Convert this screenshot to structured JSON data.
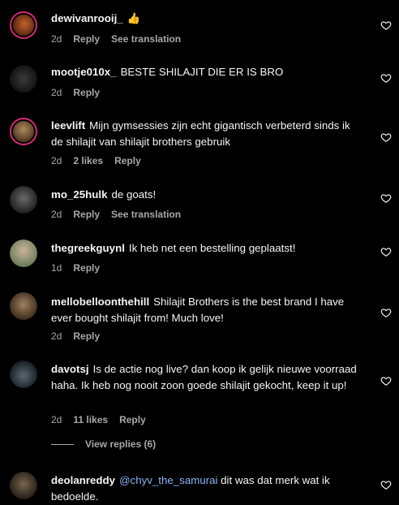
{
  "comments": [
    {
      "user": "dewivanrooij_",
      "text": "👍",
      "time": "2d",
      "likes": "",
      "actions": [
        "Reply",
        "See translation"
      ]
    },
    {
      "user": "mootje010x_",
      "text": "BESTE SHILAJIT DIE ER IS BRO",
      "time": "2d",
      "likes": "",
      "actions": [
        "Reply"
      ]
    },
    {
      "user": "leevlift",
      "text": "Mijn gymsessies zijn echt gigantisch verbeterd sinds ik de shilajit van shilajit brothers gebruik",
      "time": "2d",
      "likes": "2 likes",
      "actions": [
        "Reply"
      ]
    },
    {
      "user": "mo_25hulk",
      "text": "de goats!",
      "time": "2d",
      "likes": "",
      "actions": [
        "Reply",
        "See translation"
      ]
    },
    {
      "user": "thegreekguynl",
      "text": "Ik heb net een bestelling geplaatst!",
      "time": "1d",
      "likes": "",
      "actions": [
        "Reply"
      ]
    },
    {
      "user": "mellobelloonthehill",
      "text": "Shilajit Brothers is the best brand I have ever bought shilajit from! Much love!",
      "time": "2d",
      "likes": "",
      "actions": [
        "Reply"
      ]
    },
    {
      "user": "davotsj",
      "text": "Is de actie nog live? dan koop ik gelijk nieuwe voorraad haha. Ik heb nog nooit zoon goede shilajit gekocht, keep it up!",
      "time": "2d",
      "likes": "11 likes",
      "actions": [
        "Reply"
      ],
      "view_replies": "View replies (6)"
    },
    {
      "user": "deolanreddy",
      "mention": "@chyv_the_samurai",
      "text": " dit was dat merk wat ik bedoelde.",
      "time": "",
      "likes": "",
      "actions": []
    }
  ],
  "colors": {
    "background": "#000000",
    "text": "#f5f5f5",
    "muted": "#a8a8a8",
    "mention": "#8ab4f8",
    "story_ring": "#d62976"
  },
  "icons": {
    "like": "heart-outline-icon"
  }
}
